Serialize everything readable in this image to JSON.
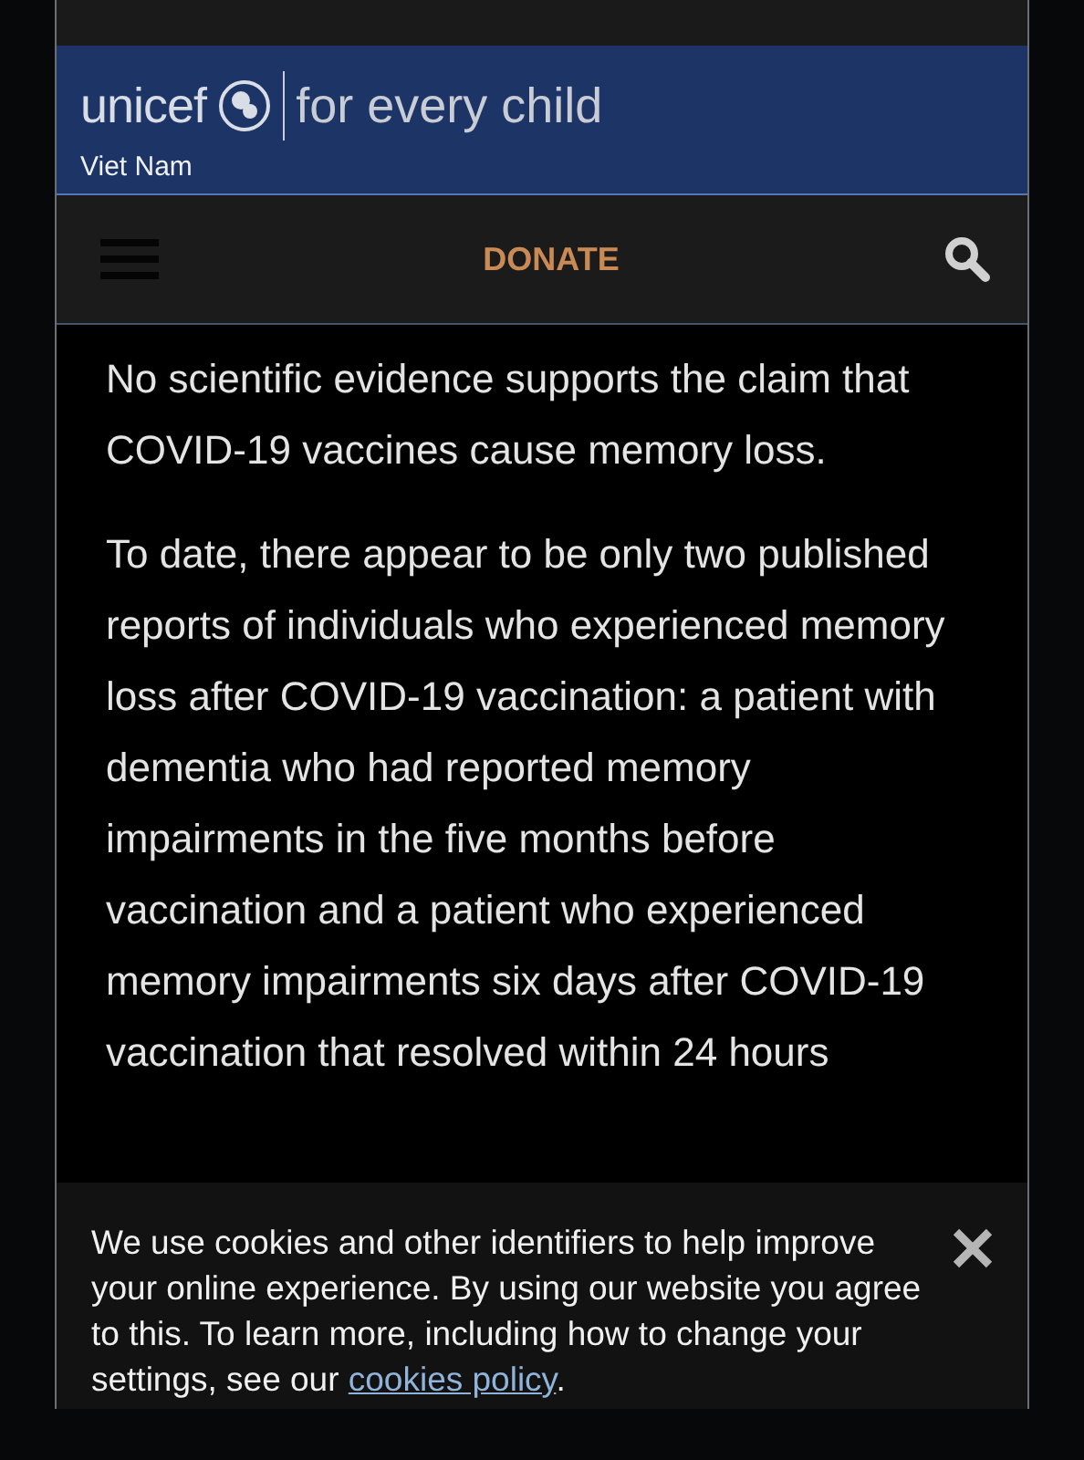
{
  "header": {
    "logo": "unicef",
    "tagline": "for every child",
    "country": "Viet Nam"
  },
  "nav": {
    "donate": "DONATE"
  },
  "article": {
    "paragraphs": [
      "No scientific evidence supports the claim that COVID-19 vaccines cause memory loss.",
      "To date, there appear to be only two published reports of individuals who experienced memory loss after COVID-19 vaccination: a patient with dementia who had reported memory impairments in the five months before vaccination and a patient who experienced memory impairments six days after COVID-19 vaccination that resolved within 24 hours"
    ]
  },
  "cookie_banner": {
    "text": "We use cookies and other identifiers to help improve your online experience. By using our website you agree to this. To learn more, including how to change your settings, see our ",
    "link": "cookies policy",
    "after": "."
  }
}
